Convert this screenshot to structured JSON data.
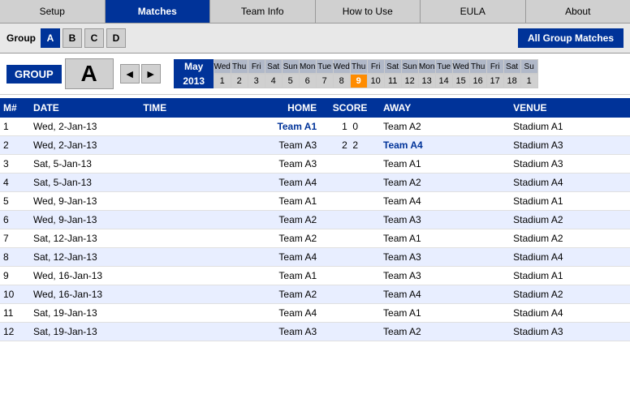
{
  "nav": {
    "items": [
      {
        "id": "setup",
        "label": "Setup",
        "active": false
      },
      {
        "id": "matches",
        "label": "Matches",
        "active": true
      },
      {
        "id": "team-info",
        "label": "Team Info",
        "active": false
      },
      {
        "id": "how-to-use",
        "label": "How to Use",
        "active": false
      },
      {
        "id": "eula",
        "label": "EULA",
        "active": false
      },
      {
        "id": "about",
        "label": "About",
        "active": false
      }
    ]
  },
  "group_tabs": {
    "label": "Group",
    "tabs": [
      "A",
      "B",
      "C",
      "D"
    ],
    "active": "A",
    "all_matches_label": "All Group Matches"
  },
  "group_selector": {
    "box_label": "GROUP",
    "current": "A",
    "prev_arrow": "◄",
    "next_arrow": "►"
  },
  "calendar": {
    "month": "May",
    "year": "2013",
    "day_names": [
      "Wed",
      "Thu",
      "Fri",
      "Sat",
      "Sun",
      "Mon",
      "Tue",
      "Wed",
      "Thu",
      "Fri",
      "Sat",
      "Sun",
      "Mon",
      "Tue",
      "Wed",
      "Thu",
      "Fri",
      "Sat",
      "Su"
    ],
    "day_numbers": [
      "1",
      "2",
      "3",
      "4",
      "5",
      "6",
      "7",
      "8",
      "9",
      "10",
      "11",
      "12",
      "13",
      "14",
      "15",
      "16",
      "17",
      "18",
      "1"
    ],
    "active_day": "9"
  },
  "table": {
    "headers": [
      "M#",
      "DATE",
      "TIME",
      "HOME",
      "SCORE",
      "AWAY",
      "VENUE"
    ],
    "rows": [
      {
        "m": "1",
        "date": "Wed, 2-Jan-13",
        "time": "",
        "home": "Team A1",
        "score1": "1",
        "score2": "0",
        "away": "Team A2",
        "venue": "Stadium A1",
        "home_winner": true,
        "away_winner": false
      },
      {
        "m": "2",
        "date": "Wed, 2-Jan-13",
        "time": "",
        "home": "Team A3",
        "score1": "2",
        "score2": "2",
        "away": "Team A4",
        "venue": "Stadium A3",
        "home_winner": false,
        "away_winner": true
      },
      {
        "m": "3",
        "date": "Sat, 5-Jan-13",
        "time": "",
        "home": "Team A3",
        "score1": "",
        "score2": "",
        "away": "Team A1",
        "venue": "Stadium A3",
        "home_winner": false,
        "away_winner": false
      },
      {
        "m": "4",
        "date": "Sat, 5-Jan-13",
        "time": "",
        "home": "Team A4",
        "score1": "",
        "score2": "",
        "away": "Team A2",
        "venue": "Stadium A4",
        "home_winner": false,
        "away_winner": false
      },
      {
        "m": "5",
        "date": "Wed, 9-Jan-13",
        "time": "",
        "home": "Team A1",
        "score1": "",
        "score2": "",
        "away": "Team A4",
        "venue": "Stadium A1",
        "home_winner": false,
        "away_winner": false
      },
      {
        "m": "6",
        "date": "Wed, 9-Jan-13",
        "time": "",
        "home": "Team A2",
        "score1": "",
        "score2": "",
        "away": "Team A3",
        "venue": "Stadium A2",
        "home_winner": false,
        "away_winner": false
      },
      {
        "m": "7",
        "date": "Sat, 12-Jan-13",
        "time": "",
        "home": "Team A2",
        "score1": "",
        "score2": "",
        "away": "Team A1",
        "venue": "Stadium A2",
        "home_winner": false,
        "away_winner": false
      },
      {
        "m": "8",
        "date": "Sat, 12-Jan-13",
        "time": "",
        "home": "Team A4",
        "score1": "",
        "score2": "",
        "away": "Team A3",
        "venue": "Stadium A4",
        "home_winner": false,
        "away_winner": false
      },
      {
        "m": "9",
        "date": "Wed, 16-Jan-13",
        "time": "",
        "home": "Team A1",
        "score1": "",
        "score2": "",
        "away": "Team A3",
        "venue": "Stadium A1",
        "home_winner": false,
        "away_winner": false
      },
      {
        "m": "10",
        "date": "Wed, 16-Jan-13",
        "time": "",
        "home": "Team A2",
        "score1": "",
        "score2": "",
        "away": "Team A4",
        "venue": "Stadium A2",
        "home_winner": false,
        "away_winner": false
      },
      {
        "m": "11",
        "date": "Sat, 19-Jan-13",
        "time": "",
        "home": "Team A4",
        "score1": "",
        "score2": "",
        "away": "Team A1",
        "venue": "Stadium A4",
        "home_winner": false,
        "away_winner": false
      },
      {
        "m": "12",
        "date": "Sat, 19-Jan-13",
        "time": "",
        "home": "Team A3",
        "score1": "",
        "score2": "",
        "away": "Team A2",
        "venue": "Stadium A3",
        "home_winner": false,
        "away_winner": false
      }
    ]
  }
}
